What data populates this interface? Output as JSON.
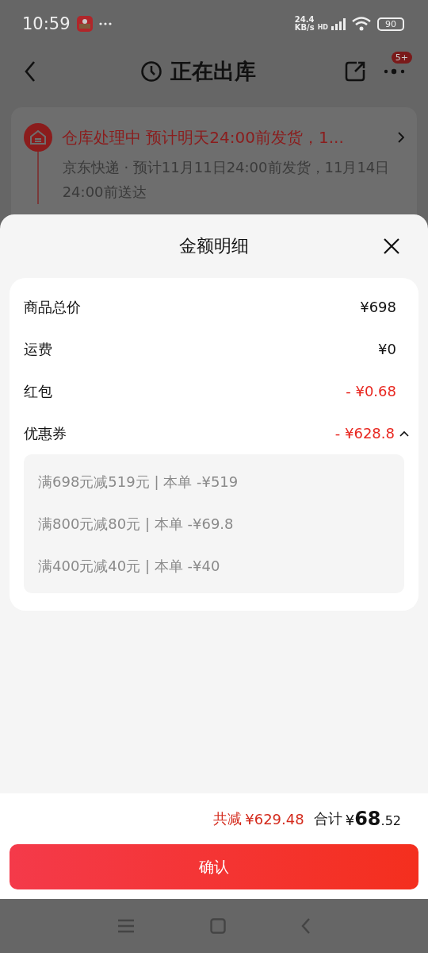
{
  "status_bar": {
    "time": "10:59",
    "speed_value": "24.4",
    "speed_unit": "KB/s",
    "network": "HD",
    "battery": "90"
  },
  "header": {
    "title": "正在出库",
    "badge": "5+"
  },
  "shipping_card": {
    "title": "仓库处理中  预计明天24:00前发货，1...",
    "detail": "京东快递 · 预计11月11日24:00前发货，11月14日24:00前送达"
  },
  "sheet": {
    "title": "金额明细",
    "rows": [
      {
        "label": "商品总价",
        "value": "¥698",
        "kind": "plain"
      },
      {
        "label": "运费",
        "value": "¥0",
        "kind": "plain"
      },
      {
        "label": "红包",
        "value": "- ¥0.68",
        "kind": "discount"
      },
      {
        "label": "优惠券",
        "value": "- ¥628.8",
        "kind": "discount",
        "expanded": true,
        "details": [
          "满698元减519元 | 本单 -¥519",
          "满800元减80元 | 本单 -¥69.8",
          "满400元减40元 | 本单 -¥40"
        ]
      }
    ]
  },
  "footer": {
    "saved_label": "共减",
    "saved_value": "¥629.48",
    "total_label": "合计",
    "total_currency": "¥",
    "total_integer": "68",
    "total_decimal": ".52",
    "confirm_button": "确认"
  }
}
